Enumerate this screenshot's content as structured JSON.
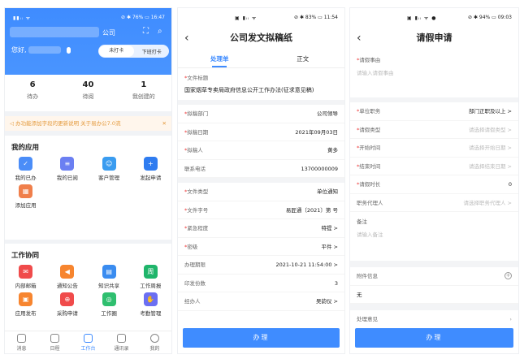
{
  "p1": {
    "status": {
      "left": "▮▮ᵢₗ ᯤ",
      "right": "⊘ ✱ 76% ▭ 16:47"
    },
    "company": "公司",
    "greeting": "您好,",
    "punch": {
      "a": "未打卡",
      "b": "下班打卡"
    },
    "stats": [
      {
        "n": "6",
        "t": "待办"
      },
      {
        "n": "40",
        "t": "待阅"
      },
      {
        "n": "1",
        "t": "我创建的"
      }
    ],
    "notice": "办功能添加字段的更新说明   关于易办公7.0流",
    "myapps_title": "我的应用",
    "myapps": [
      "我的已办",
      "我的已阅",
      "客户管理",
      "发起申请",
      "添加应用"
    ],
    "work_title": "工作协同",
    "work": [
      "内部邮箱",
      "通知公告",
      "知识共享",
      "工作周报",
      "应用发布",
      "采购申请",
      "工作圈",
      "考勤管理"
    ],
    "tabs": [
      "消息",
      "日程",
      "工作台",
      "通讯录",
      "我的"
    ]
  },
  "p2": {
    "status": {
      "left": "▣ ▮ᵢₗ ᯤ",
      "right": "⊘ ✱ 83% ▭ 11:54"
    },
    "title": "公司发文拟稿纸",
    "segs": [
      "处理单",
      "正文"
    ],
    "doc_title_label": "文件标题",
    "doc_title": "国家烟草专卖局政府信息公开工作办法(征求意见稿)",
    "g1": [
      {
        "k": "拟稿部门",
        "v": "公司领导",
        "req": true
      },
      {
        "k": "拟稿日期",
        "v": "2021年09月03日",
        "req": true
      },
      {
        "k": "拟稿人",
        "v": "黄多",
        "req": true
      },
      {
        "k": "联系电话",
        "v": "13700000009",
        "req": false
      }
    ],
    "g2": [
      {
        "k": "文件类型",
        "v": "单位通知",
        "req": true
      },
      {
        "k": "文件字号",
        "v": "易匠通〔2021〕第 号",
        "req": true
      },
      {
        "k": "紧急程度",
        "v": "特提 >",
        "req": true
      },
      {
        "k": "密级",
        "v": "平件 >",
        "req": true
      },
      {
        "k": "办理期限",
        "v": "2021-10-21 11:54:00 >",
        "req": false
      },
      {
        "k": "印发份数",
        "v": "3",
        "req": false
      },
      {
        "k": "经办人",
        "v": "吴韵仪 >",
        "req": false
      }
    ],
    "button": "办理"
  },
  "p3": {
    "status": {
      "left": "▣ ▮ᵢₗ ᯤ ●",
      "right": "⊘ ✱ 94% ▭ 09:03"
    },
    "title": "请假申请",
    "reason_label": "请假事由",
    "reason_ph": "请输入请假事由",
    "rows": [
      {
        "k": "单位职务",
        "v": "部门正职及以上 >",
        "req": true,
        "ph": false
      },
      {
        "k": "请假类型",
        "v": "请选择请假类型 >",
        "req": true,
        "ph": true
      },
      {
        "k": "开始时间",
        "v": "请选择开始日期 >",
        "req": true,
        "ph": true
      },
      {
        "k": "结束时间",
        "v": "请选择结束日期 >",
        "req": true,
        "ph": true
      },
      {
        "k": "请假时长",
        "v": "0",
        "req": true,
        "ph": false
      },
      {
        "k": "职务代理人",
        "v": "请选择职务代理人 >",
        "req": false,
        "ph": true
      }
    ],
    "remark_label": "备注",
    "remark_ph": "请输入备注",
    "attach_label": "附件信息",
    "attach_value": "无",
    "opinion_label": "处理意见",
    "button": "办理"
  },
  "colors": {
    "accent": "#3f8cff",
    "notice": "#e49b3f"
  }
}
